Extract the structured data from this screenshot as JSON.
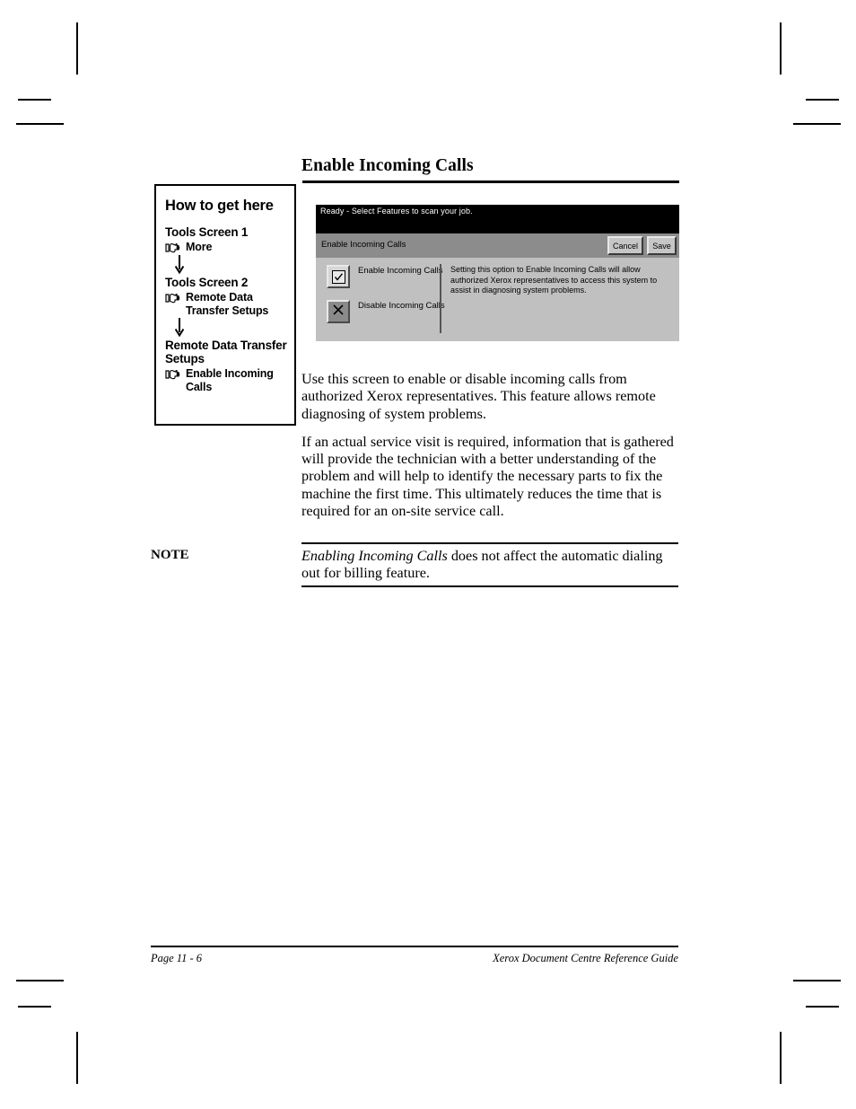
{
  "page": {
    "title": "Enable Incoming Calls"
  },
  "sidebar": {
    "heading": "How to get here",
    "steps": [
      {
        "screen": "Tools Screen 1",
        "icon": "pointing-hand-icon",
        "item": "More",
        "arrow": "down-arrow-icon"
      },
      {
        "screen": "Tools Screen 2",
        "icon": "pointing-hand-icon",
        "item": "Remote Data Transfer Setups",
        "arrow": "down-arrow-icon"
      },
      {
        "screen": "Remote Data Transfer Setups",
        "icon": "pointing-hand-icon",
        "item": "Enable Incoming Calls",
        "arrow": ""
      }
    ]
  },
  "ui_screen": {
    "status_text": "Ready -  Select Features to scan your job.",
    "dialog_title": "Enable Incoming Calls",
    "buttons": {
      "cancel": "Cancel",
      "save": "Save"
    },
    "options": [
      {
        "label": "Enable Incoming Calls",
        "state": "selected",
        "icon": "checkmark-icon"
      },
      {
        "label": "Disable Incoming Calls",
        "state": "unselected",
        "icon": "x-mark-icon"
      }
    ],
    "description": "Setting this option to Enable Incoming Calls will allow authorized Xerox representatives to access this system to assist in diagnosing system problems.",
    "colors": {
      "statusbar_bg": "#000000",
      "titlebar_bg": "#8c8c8c",
      "body_bg": "#c0c0c0",
      "button_bg": "#c6c6c6"
    }
  },
  "body": {
    "paragraph_1": "Use this screen to enable or disable incoming calls from authorized Xerox representatives. This feature allows remote diagnosing of system problems.",
    "paragraph_2": "If an actual service visit is required, information that is gathered will provide the technician with a better understanding of the problem and will help to identify the necessary parts to fix the machine the first time. This ultimately reduces the time that is required for an on-site service call."
  },
  "note": {
    "label": "NOTE",
    "emphasis": "Enabling Incoming Calls",
    "text": " does not affect the automatic dialing out for billing feature."
  },
  "footer": {
    "page_number": "Page 11 - 6",
    "guide_title": "Xerox Document Centre Reference Guide"
  }
}
